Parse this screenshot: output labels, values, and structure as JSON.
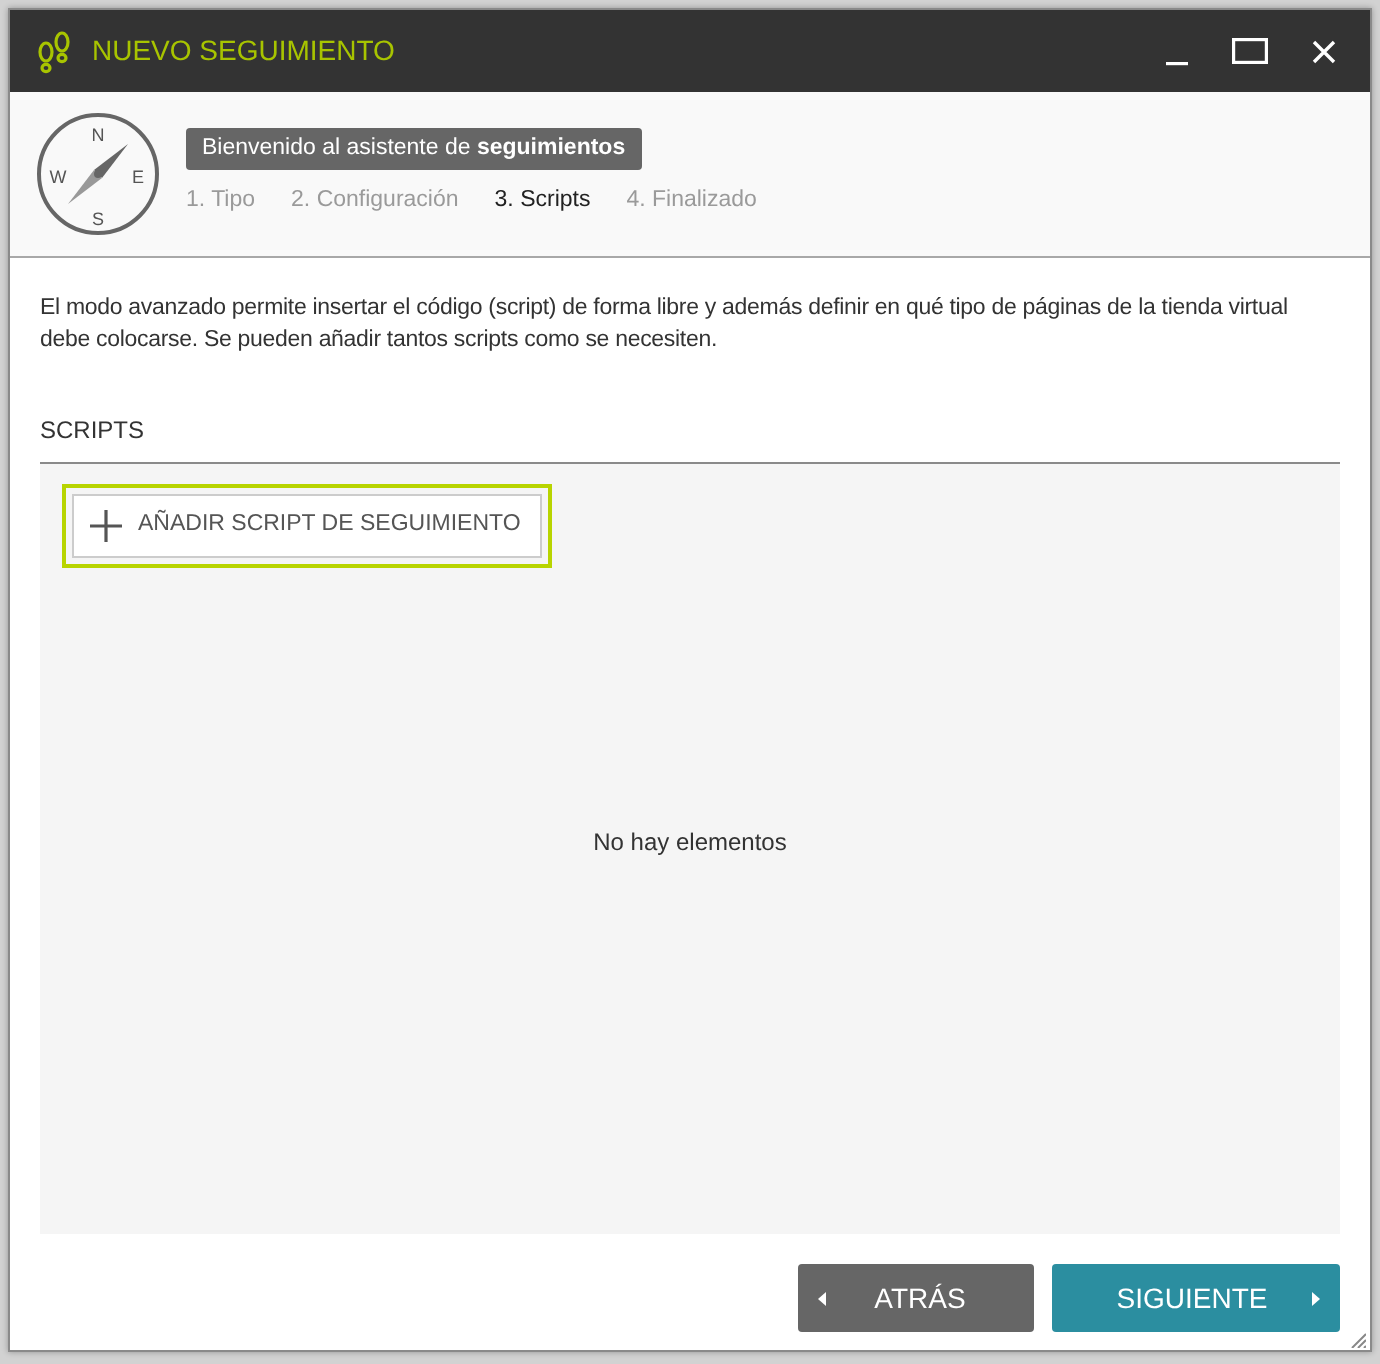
{
  "window": {
    "title": "NUEVO SEGUIMIENTO"
  },
  "header": {
    "compass_letters": [
      "N",
      "E",
      "S",
      "W"
    ],
    "welcome": "Bienvenido al asistente de **seguimientos**",
    "steps": [
      {
        "label": "1. Tipo",
        "selected": false
      },
      {
        "label": "2. Configuración",
        "selected": false
      },
      {
        "label": "3. Scripts",
        "selected": true
      },
      {
        "label": "4. Finalizado",
        "selected": false
      }
    ]
  },
  "description": "El modo avanzado permite insertar el código (script) de forma libre y además definir en qué tipo de páginas de la tienda virtual debe colocarse. Se pueden añadir tantos scripts como se necesiten.",
  "section": {
    "title": "SCRIPTS",
    "add_button": {
      "label": "AÑADIR SCRIPT DE SEGUIMIENTO",
      "focused": true
    },
    "empty_message": "No hay elementos"
  },
  "footer": {
    "buttons": [
      {
        "label": "ATRÁS",
        "kind": "back"
      },
      {
        "label": "SIGUIENTE",
        "kind": "next"
      }
    ]
  }
}
